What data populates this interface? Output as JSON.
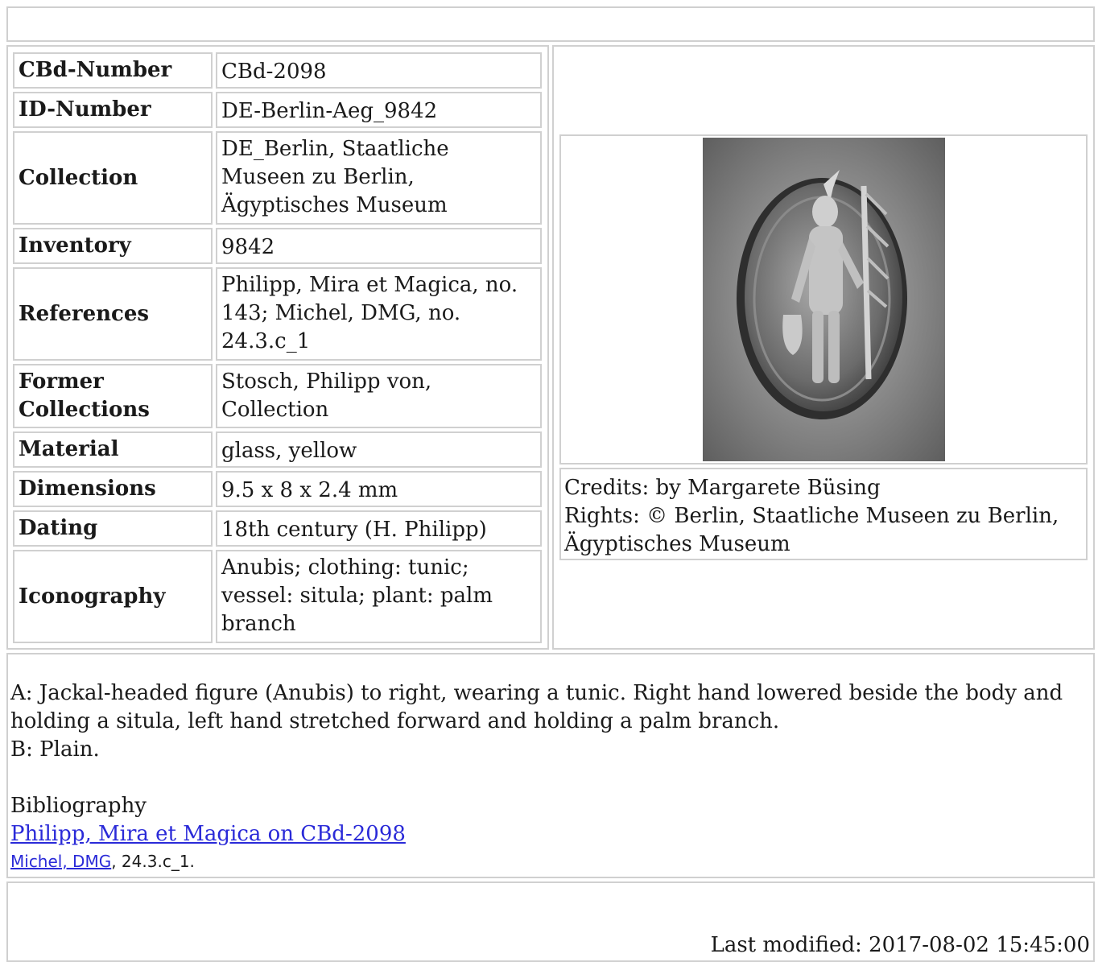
{
  "record": {
    "rows": [
      {
        "label": "CBd-Number",
        "value": "CBd-2098"
      },
      {
        "label": "ID-Number",
        "value": "DE-Berlin-Aeg_9842"
      },
      {
        "label": "Collection",
        "value": "DE_Berlin, Staatliche Museen zu Berlin, Ägyptisches Museum"
      },
      {
        "label": "Inventory",
        "value": "9842"
      },
      {
        "label": "References",
        "value": "Philipp, Mira et Magica, no. 143; Michel, DMG, no. 24.3.c_1"
      },
      {
        "label": "Former Collections",
        "value": "Stosch, Philipp von, Collection"
      },
      {
        "label": "Material",
        "value": "glass, yellow"
      },
      {
        "label": "Dimensions",
        "value": "9.5 x 8 x 2.4 mm"
      },
      {
        "label": "Dating",
        "value": "18th century (H. Philipp)"
      },
      {
        "label": "Iconography",
        "value": "Anubis; clothing: tunic; vessel: situla; plant: palm branch"
      }
    ]
  },
  "image": {
    "credits": "Credits: by Margarete Büsing",
    "rights": "Rights: © Berlin, Staatliche Museen zu Berlin, Ägyptisches Museum"
  },
  "description": {
    "text": "A: Jackal-headed figure (Anubis) to right, wearing a tunic. Right hand lowered beside the body and holding a situla, left hand stretched forward and holding a palm branch.\nB: Plain."
  },
  "bibliography": {
    "heading": "Bibliography",
    "link1": "Philipp, Mira et Magica on CBd-2098",
    "link2": "Michel, DMG",
    "link2_suffix": ", 24.3.c_1."
  },
  "footer": {
    "last_modified": "Last modified: 2017-08-02 15:45:00"
  },
  "colors": {
    "border": "#d0d0d0",
    "link": "#2a2ad8"
  }
}
